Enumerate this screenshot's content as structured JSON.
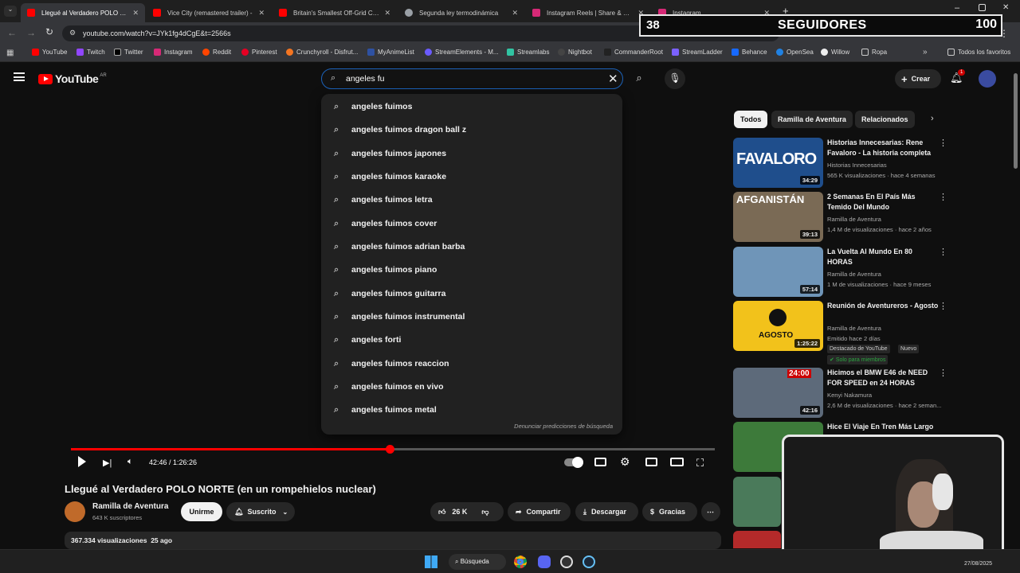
{
  "tabs": [
    {
      "title": "Llegué al Verdadero POLO NORTE",
      "color": "#ff0000"
    },
    {
      "title": "Vice City (remastered trailer) -",
      "color": "#ff0000"
    },
    {
      "title": "Britain's Smallest Off-Grid Cab",
      "color": "#ff0000"
    },
    {
      "title": "Segunda ley termodinámica",
      "color": "#9aa0a6"
    },
    {
      "title": "Instagram Reels | Share & Crea",
      "color": "#d62976"
    },
    {
      "title": "Instagram",
      "color": "#d62976"
    }
  ],
  "omnibox": {
    "url": "youtube.com/watch?v=JYk1fg4dCgE&t=2566s"
  },
  "bookmarks": [
    "YouTube",
    "Twitch",
    "Twitter",
    "Instagram",
    "Reddit",
    "Pinterest",
    "Crunchyroll - Disfrut...",
    "MyAnimeList",
    "StreamElements - M...",
    "Streamlabs",
    "Nightbot",
    "CommanderRoot",
    "StreamLadder",
    "Behance",
    "OpenSea",
    "Willow",
    "Ropa"
  ],
  "bookmarks_all": "Todos los favoritos",
  "followers": {
    "count": "38",
    "label": "SEGUIDORES",
    "goal": "100"
  },
  "youtube": {
    "logo": "YouTube",
    "region": "AR",
    "create": "Crear",
    "notif": "1"
  },
  "search": {
    "value": "angeles fu"
  },
  "suggestions": [
    "angeles fuimos",
    "angeles fuimos dragon ball z",
    "angeles fuimos japones",
    "angeles fuimos karaoke",
    "angeles fuimos letra",
    "angeles fuimos cover",
    "angeles fuimos adrian barba",
    "angeles fuimos piano",
    "angeles fuimos guitarra",
    "angeles fuimos instrumental",
    "angeles forti",
    "angeles fuimos reaccion",
    "angeles fuimos en vivo",
    "angeles fuimos metal"
  ],
  "report_predictions": "Denunciar predicciones de búsqueda",
  "player": {
    "time": "42:46 / 1:26:26",
    "progress": 0.4947
  },
  "video": {
    "title": "Llegué al Verdadero POLO NORTE (en un rompehielos nuclear)",
    "channel": "Ramilla de Aventura",
    "subs": "643 K suscriptores",
    "join": "Unirme",
    "subscribed": "Suscrito",
    "likes": "26 K",
    "share": "Compartir",
    "download": "Descargar",
    "thanks": "Gracias",
    "views": "367.334 visualizaciones",
    "ago": "25 ago"
  },
  "chips": [
    "Todos",
    "Ramilla de Aventura",
    "Relacionados"
  ],
  "recs": [
    {
      "title": "Historias Innecesarias: Rene Favaloro - La historia completa",
      "channel": "Historias Innecesarias",
      "meta": "565 K visualizaciones · hace 4 semanas",
      "dur": "34:29",
      "thumb_text": "FAVALORO",
      "color": "#1f4e8c"
    },
    {
      "title": "2 Semanas En El País Más Temido Del Mundo",
      "channel": "Ramilla de Aventura",
      "meta": "1,4 M de visualizaciones · hace 2 años",
      "dur": "39:13",
      "thumb_text": "AFGANISTÁN",
      "color": "#7a6a55"
    },
    {
      "title": "La Vuelta Al Mundo En 80 HORAS",
      "channel": "Ramilla de Aventura",
      "meta": "1 M de visualizaciones · hace 9 meses",
      "dur": "57:14",
      "thumb_text": "",
      "color": "#6f95b8"
    },
    {
      "title": "Reunión de Aventureros - Agosto",
      "channel": "Ramilla de Aventura",
      "meta": "Emitido hace 2 días",
      "dur": "1:25:22",
      "thumb_text": "AGOSTO",
      "color": "#f2c21b",
      "badge1": "Destacado de YouTube",
      "badge2": "Nuevo",
      "members": "Solo para miembros"
    },
    {
      "title": "Hicimos el BMW E46 de NEED FOR SPEED en 24 HORAS",
      "channel": "Kenyi Nakamura",
      "meta": "2,6 M de visualizaciones · hace 2 seman...",
      "dur": "42:16",
      "thumb_text": "24:00",
      "color": "#5d6a7a"
    },
    {
      "title": "Hice El Viaje En Tren Más Largo",
      "channel": "",
      "meta": "",
      "dur": "",
      "thumb_text": "",
      "color": "#3d7a3a"
    }
  ],
  "taskbar": {
    "search": "Búsqueda",
    "date": "27/08/2025"
  }
}
